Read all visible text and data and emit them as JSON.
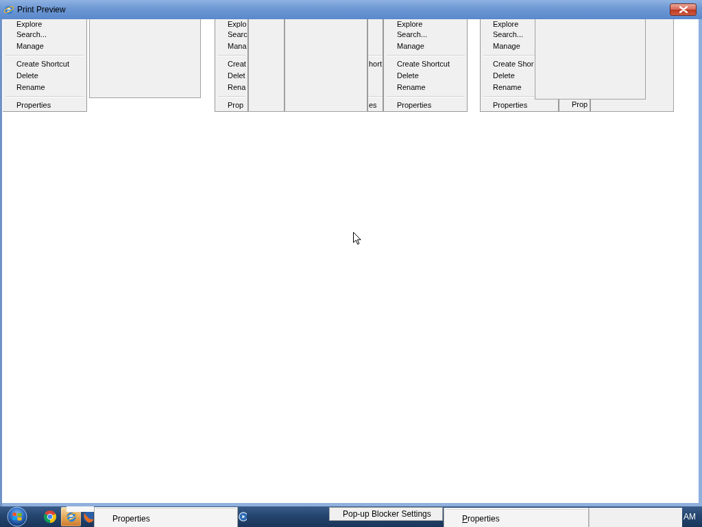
{
  "window": {
    "title": "Print Preview"
  },
  "context_menus": [
    {
      "items": [
        {
          "kind": "item",
          "label": "Explore"
        },
        {
          "kind": "item",
          "label": "Search..."
        },
        {
          "kind": "item",
          "label": "Manage"
        },
        {
          "kind": "separator"
        },
        {
          "kind": "item",
          "label": "Create Shortcut"
        },
        {
          "kind": "item",
          "label": "Delete"
        },
        {
          "kind": "item",
          "label": "Rename"
        },
        {
          "kind": "separator"
        },
        {
          "kind": "item",
          "label": "Properties"
        }
      ]
    },
    {
      "items": [
        {
          "kind": "item",
          "label": "Explo"
        },
        {
          "kind": "item",
          "label": "Searc"
        },
        {
          "kind": "item",
          "label": "Mana"
        },
        {
          "kind": "separator"
        },
        {
          "kind": "item",
          "label": "Creat"
        },
        {
          "kind": "item",
          "label": "Delet"
        },
        {
          "kind": "item",
          "label": "Rena"
        },
        {
          "kind": "separator"
        },
        {
          "kind": "item",
          "label": "Prop"
        }
      ]
    },
    {
      "items": [
        {
          "kind": "spacer"
        },
        {
          "kind": "spacer"
        },
        {
          "kind": "spacer"
        },
        {
          "kind": "separator"
        },
        {
          "kind": "item",
          "label": "hort"
        },
        {
          "kind": "spacer"
        },
        {
          "kind": "spacer"
        },
        {
          "kind": "separator"
        },
        {
          "kind": "item",
          "label": "es"
        }
      ]
    },
    {
      "items": [
        {
          "kind": "item",
          "label": "Explore"
        },
        {
          "kind": "item",
          "label": "Search..."
        },
        {
          "kind": "item",
          "label": "Manage"
        },
        {
          "kind": "separator"
        },
        {
          "kind": "item",
          "label": "Create Shortcut"
        },
        {
          "kind": "item",
          "label": "Delete"
        },
        {
          "kind": "item",
          "label": "Rename"
        },
        {
          "kind": "separator"
        },
        {
          "kind": "item",
          "label": "Properties"
        }
      ]
    },
    {
      "items": [
        {
          "kind": "item",
          "label": "Explore"
        },
        {
          "kind": "item",
          "label": "Search..."
        },
        {
          "kind": "item",
          "label": "Manage"
        },
        {
          "kind": "separator"
        },
        {
          "kind": "item",
          "label": "Create Shor"
        },
        {
          "kind": "item",
          "label": "Delete"
        },
        {
          "kind": "item",
          "label": "Rename"
        },
        {
          "kind": "separator"
        },
        {
          "kind": "item",
          "label": "Properties"
        }
      ]
    },
    {
      "items": [
        {
          "kind": "item",
          "label": "Prop"
        }
      ]
    }
  ],
  "taskbar": {
    "buttons": [
      {
        "selected": false
      },
      {
        "selected": true
      },
      {
        "selected": false
      }
    ],
    "ghosts": [
      {
        "kind": "menu_fragment",
        "label": "Properties",
        "access_key_shown": false
      },
      {
        "kind": "menu_item",
        "label": "Pop-up Blocker Settings"
      },
      {
        "kind": "menu_fragment",
        "label": "Properties",
        "access_key_shown": true
      }
    ],
    "clock": "AM"
  }
}
